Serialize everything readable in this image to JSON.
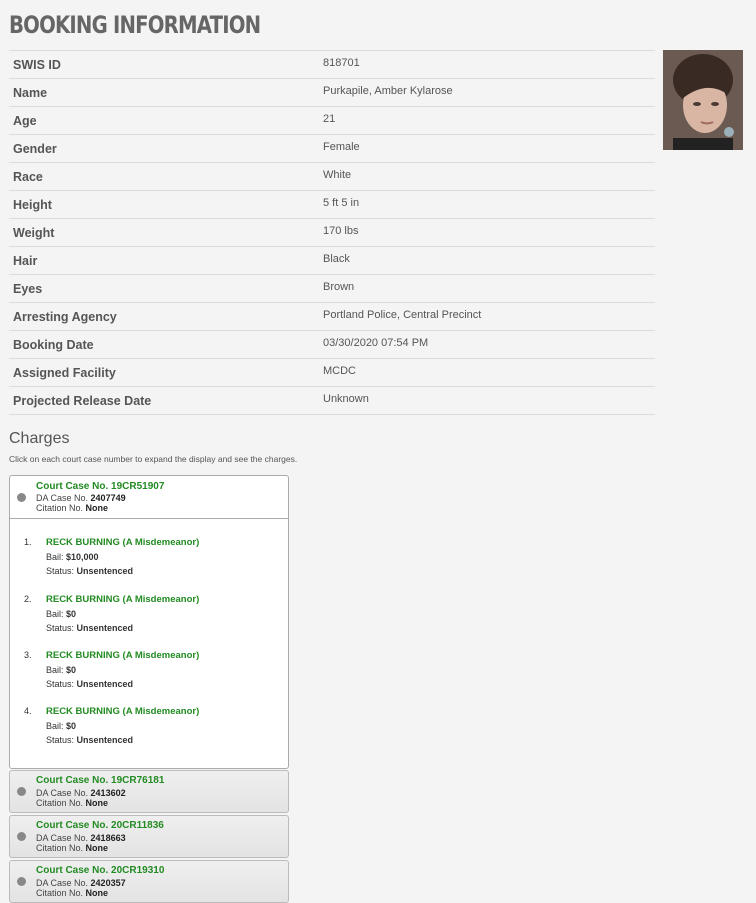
{
  "page_title": "BOOKING INFORMATION",
  "booking": [
    {
      "label": "SWIS ID",
      "value": "818701"
    },
    {
      "label": "Name",
      "value": "Purkapile, Amber Kylarose"
    },
    {
      "label": "Age",
      "value": "21"
    },
    {
      "label": "Gender",
      "value": "Female"
    },
    {
      "label": "Race",
      "value": "White"
    },
    {
      "label": "Height",
      "value": "5 ft 5 in"
    },
    {
      "label": "Weight",
      "value": "170 lbs"
    },
    {
      "label": "Hair",
      "value": "Black"
    },
    {
      "label": "Eyes",
      "value": "Brown"
    },
    {
      "label": "Arresting Agency",
      "value": "Portland Police, Central Precinct"
    },
    {
      "label": "Booking Date",
      "value": "03/30/2020 07:54 PM"
    },
    {
      "label": "Assigned Facility",
      "value": "MCDC"
    },
    {
      "label": "Projected Release Date",
      "value": "Unknown"
    }
  ],
  "charges": {
    "heading": "Charges",
    "note": "Click on each court case number to expand the display and see the charges.",
    "labels": {
      "court_case": "Court Case No.",
      "da_case": "DA Case No.",
      "citation": "Citation No.",
      "bail": "Bail:",
      "status": "Status:"
    },
    "cases": [
      {
        "court_case": "19CR51907",
        "da_case": "2407749",
        "citation": "None",
        "expanded": true,
        "charges": [
          {
            "num": "1.",
            "name": "RECK BURNING (A Misdemeanor)",
            "bail": "$10,000",
            "status": "Unsentenced"
          },
          {
            "num": "2.",
            "name": "RECK BURNING (A Misdemeanor)",
            "bail": "$0",
            "status": "Unsentenced"
          },
          {
            "num": "3.",
            "name": "RECK BURNING (A Misdemeanor)",
            "bail": "$0",
            "status": "Unsentenced"
          },
          {
            "num": "4.",
            "name": "RECK BURNING (A Misdemeanor)",
            "bail": "$0",
            "status": "Unsentenced"
          }
        ]
      },
      {
        "court_case": "19CR76181",
        "da_case": "2413602",
        "citation": "None",
        "expanded": false
      },
      {
        "court_case": "20CR11836",
        "da_case": "2418663",
        "citation": "None",
        "expanded": false
      },
      {
        "court_case": "20CR19310",
        "da_case": "2420357",
        "citation": "None",
        "expanded": false
      }
    ]
  }
}
